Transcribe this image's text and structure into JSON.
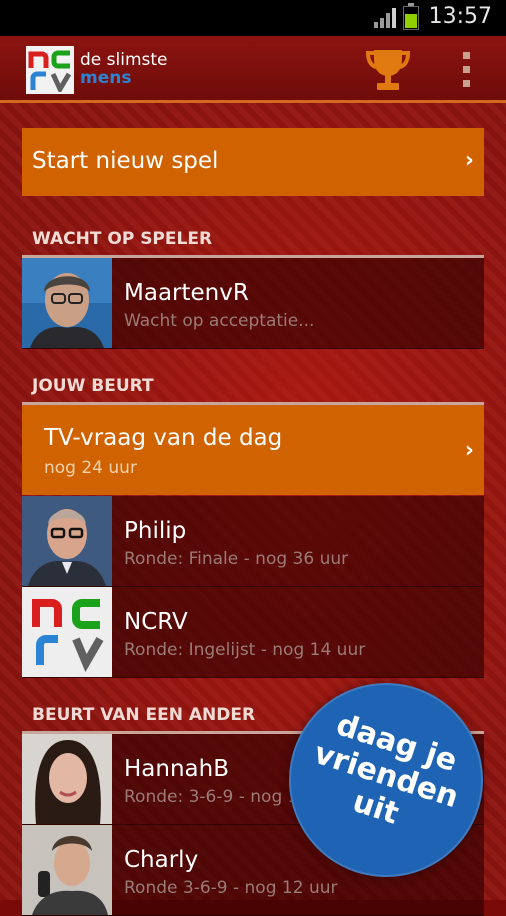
{
  "status_bar": {
    "time": "13:57"
  },
  "app_bar": {
    "logo_letters": [
      "n",
      "c",
      "r",
      "v"
    ],
    "brand_line1": "de slimste",
    "brand_line2": "mens",
    "trophy_icon": "trophy-icon",
    "menu_icon": "overflow-menu-icon"
  },
  "start_button": {
    "label": "Start nieuw spel",
    "chevron": "›"
  },
  "sections": [
    {
      "title": "WACHT OP SPELER",
      "rows": [
        {
          "name": "MaartenvR",
          "sub": "Wacht op acceptatie..."
        }
      ]
    },
    {
      "title": "JOUW BEURT",
      "featured": {
        "name": "TV-vraag van de dag",
        "sub": "nog 24 uur",
        "chevron": "›"
      },
      "rows": [
        {
          "name": "Philip",
          "sub": "Ronde: Finale - nog 36 uur"
        },
        {
          "name": "NCRV",
          "sub": "Ronde: Ingelijst - nog 14 uur"
        }
      ]
    },
    {
      "title": "BEURT VAN EEN ANDER",
      "rows": [
        {
          "name": "HannahB",
          "sub": "Ronde: 3-6-9 - nog 12 uur"
        },
        {
          "name": "Charly",
          "sub": "Ronde 3-6-9 - nog 12 uur"
        }
      ]
    }
  ],
  "promo": {
    "line1": "daag je",
    "line2": "vrienden",
    "line3": "uit"
  },
  "colors": {
    "accent_orange": "#d06200",
    "brand_blue": "#1f63b4",
    "background_red": "#8d1410"
  }
}
